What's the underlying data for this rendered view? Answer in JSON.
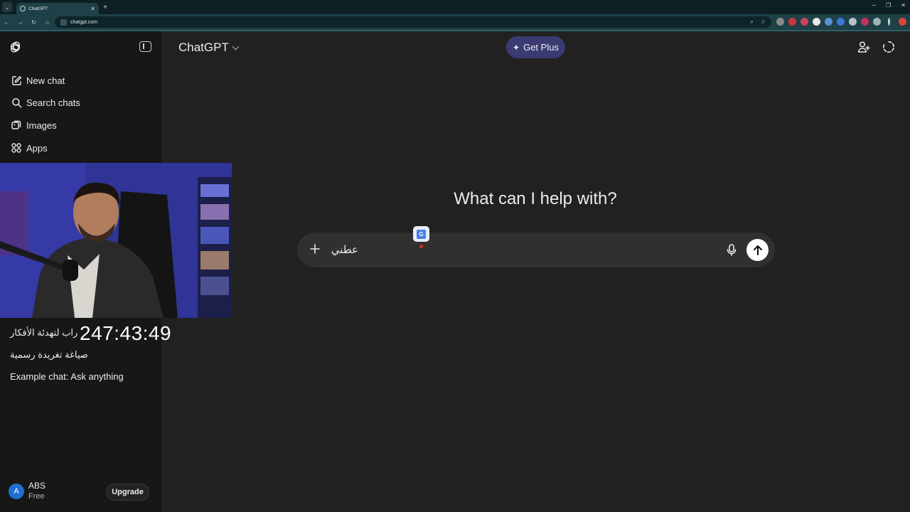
{
  "browser": {
    "tab_title": "ChatGPT",
    "url": "chatgpt.com"
  },
  "sidebar": {
    "items": [
      {
        "label": "New chat",
        "icon": "edit-icon"
      },
      {
        "label": "Search chats",
        "icon": "search-icon"
      },
      {
        "label": "Images",
        "icon": "images-icon"
      },
      {
        "label": "Apps",
        "icon": "apps-icon"
      }
    ],
    "recent_chats": [
      "راب لتهدئة الأفكار",
      "صياغة تغريدة رسمية",
      "Example chat: Ask anything"
    ],
    "user": {
      "avatar_letter": "A",
      "name": "ABS",
      "plan": "Free",
      "upgrade_label": "Upgrade"
    }
  },
  "overlay": {
    "timer": "247:43:49"
  },
  "header": {
    "model_name": "ChatGPT",
    "get_plus_label": "Get Plus"
  },
  "main": {
    "headline": "What can I help with?",
    "composer": {
      "value": "عطني"
    }
  },
  "colors": {
    "sidebar_bg": "#171717",
    "main_bg": "#212121",
    "composer_bg": "#303030",
    "get_plus_bg": "#3b3a73",
    "avatar_bg": "#1f6fd1"
  }
}
